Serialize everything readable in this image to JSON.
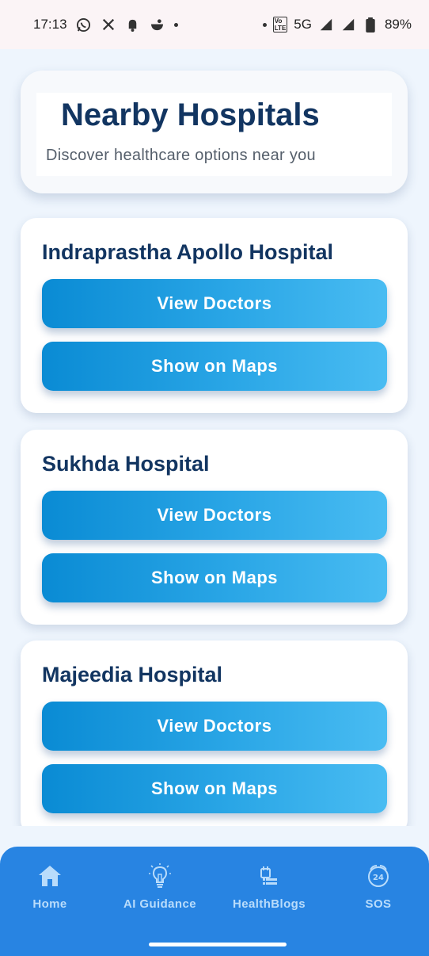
{
  "status_bar": {
    "time": "17:13",
    "left_icons": [
      "whatsapp-icon",
      "x-icon",
      "bell-icon",
      "bowl-icon"
    ],
    "network": "5G",
    "battery": "89%"
  },
  "header": {
    "title": "Nearby Hospitals",
    "subtitle": "Discover healthcare options near you"
  },
  "hospitals": [
    {
      "name": "Indraprastha Apollo Hospital",
      "doctors_label": "View Doctors",
      "maps_label": "Show on Maps"
    },
    {
      "name": "Sukhda Hospital",
      "doctors_label": "View Doctors",
      "maps_label": "Show on Maps"
    },
    {
      "name": "Majeedia Hospital",
      "doctors_label": "View Doctors",
      "maps_label": "Show on Maps"
    }
  ],
  "nav": {
    "items": [
      {
        "label": "Home",
        "icon": "home-icon"
      },
      {
        "label": "AI Guidance",
        "icon": "lightbulb-icon"
      },
      {
        "label": "HealthBlogs",
        "icon": "blog-icon"
      },
      {
        "label": "SOS",
        "icon": "sos-24-icon"
      }
    ]
  },
  "colors": {
    "title": "#123561",
    "button_start": "#0a8bd4",
    "button_end": "#49bcf2",
    "nav_bg": "#2884e2",
    "page_bg": "#eef5fd"
  }
}
